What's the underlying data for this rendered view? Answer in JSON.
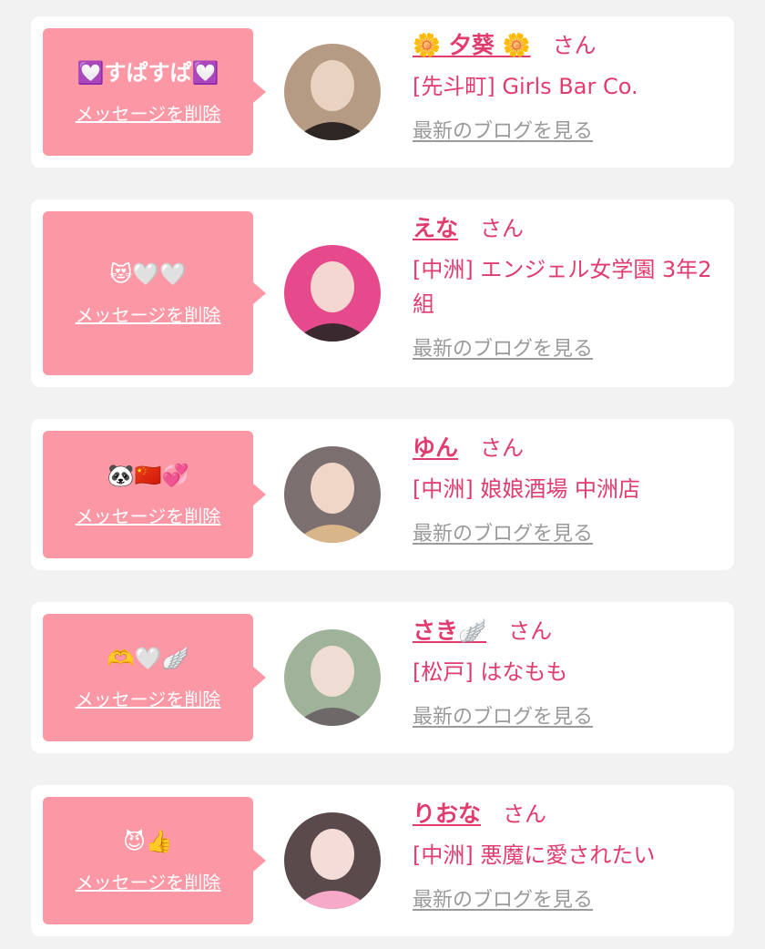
{
  "cards": [
    {
      "comment": "💟すぱすぱ💟",
      "delete_label": "メッセージを削除",
      "name": "🌼 夕葵 🌼",
      "honorific": "さん",
      "shop": "[先斗町] Girls Bar Co.",
      "blog_label": "最新のブログを見る",
      "avatar_colors": [
        "#b59a84",
        "#e8d2c0",
        "#2e2623"
      ]
    },
    {
      "comment": "😻🤍🤍",
      "delete_label": "メッセージを削除",
      "name": "えな",
      "honorific": "さん",
      "shop": "[中洲] エンジェル女学園 3年2組",
      "blog_label": "最新のブログを見る",
      "avatar_colors": [
        "#e64a8c",
        "#f3d7d0",
        "#3a2a2f"
      ]
    },
    {
      "comment": "🐼🇨🇳💞",
      "delete_label": "メッセージを削除",
      "name": "ゆん",
      "honorific": "さん",
      "shop": "[中洲] 娘娘酒場 中洲店",
      "blog_label": "最新のブログを見る",
      "avatar_colors": [
        "#7b6f70",
        "#f0d6c6",
        "#d9b58a"
      ]
    },
    {
      "comment": "🫶🤍🪽",
      "delete_label": "メッセージを削除",
      "name": "さき🪽",
      "honorific": "さん",
      "shop": "[松戸] はなもも",
      "blog_label": "最新のブログを見る",
      "avatar_colors": [
        "#9fb39a",
        "#efdcd2",
        "#6f6868"
      ]
    },
    {
      "comment": "😈👍",
      "delete_label": "メッセージを削除",
      "name": "りおな",
      "honorific": "さん",
      "shop": "[中洲] 悪魔に愛されたい",
      "blog_label": "最新のブログを見る",
      "avatar_colors": [
        "#5a4a4c",
        "#f4ddd8",
        "#f6a9c8"
      ]
    }
  ]
}
